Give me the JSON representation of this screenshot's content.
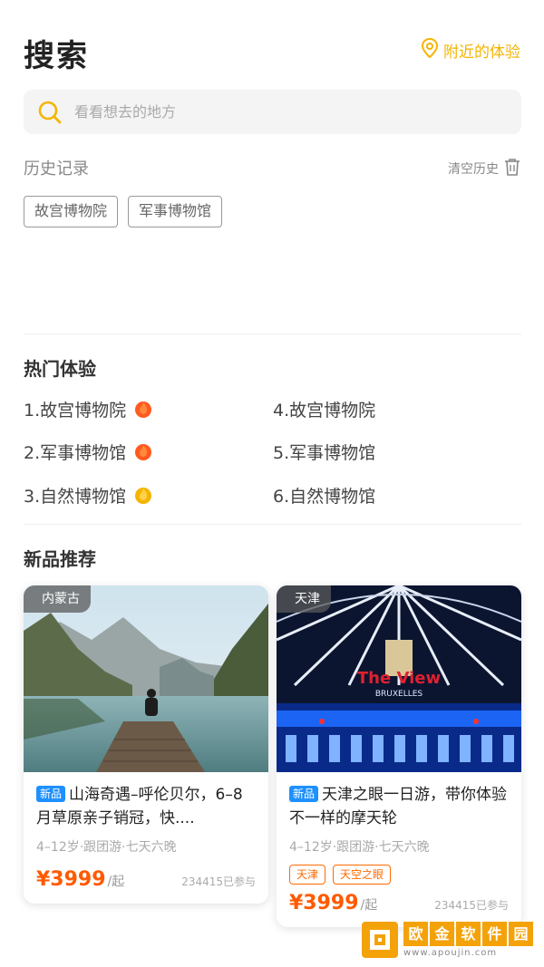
{
  "header": {
    "title": "搜索",
    "nearby_label": "附近的体验"
  },
  "search": {
    "placeholder": "看看想去的地方",
    "value": ""
  },
  "history": {
    "title": "历史记录",
    "clear_label": "清空历史",
    "tags": [
      "故宫博物院",
      "军事博物馆"
    ]
  },
  "hot": {
    "title": "热门体验",
    "items": [
      {
        "label": "1.故宫博物院",
        "flame": "red"
      },
      {
        "label": "2.军事博物馆",
        "flame": "red"
      },
      {
        "label": "3.自然博物馆",
        "flame": "yellow"
      },
      {
        "label": "4.故宫博物院",
        "flame": ""
      },
      {
        "label": "5.军事博物馆",
        "flame": ""
      },
      {
        "label": "6.自然博物馆",
        "flame": ""
      }
    ]
  },
  "new_products": {
    "title": "新品推荐",
    "cards": [
      {
        "location": "内蒙古",
        "badge": "新品",
        "title": "山海奇遇–呼伦贝尔，6–8月草原亲子销冠，快....",
        "sub": "4–12岁·跟团游·七天六晚",
        "tags": [],
        "price": "¥3999",
        "price_unit": "/起",
        "joined": "234415已参与"
      },
      {
        "location": "天津",
        "badge": "新品",
        "title": "天津之眼一日游，带你体验不一样的摩天轮",
        "sub": "4–12岁·跟团游·七天六晚",
        "tags": [
          "天津",
          "天空之眼"
        ],
        "price": "¥3999",
        "price_unit": "/起",
        "joined": "234415已参与"
      }
    ]
  },
  "watermark": {
    "chars": [
      "欧",
      "金",
      "软",
      "件",
      "园"
    ],
    "url": "www.apoujin.com"
  },
  "colors": {
    "accent": "#f5b400",
    "price": "#ff5a00",
    "badge": "#1e90ff",
    "flame_red": "#ff5a1f",
    "flame_yellow": "#f5b400"
  }
}
